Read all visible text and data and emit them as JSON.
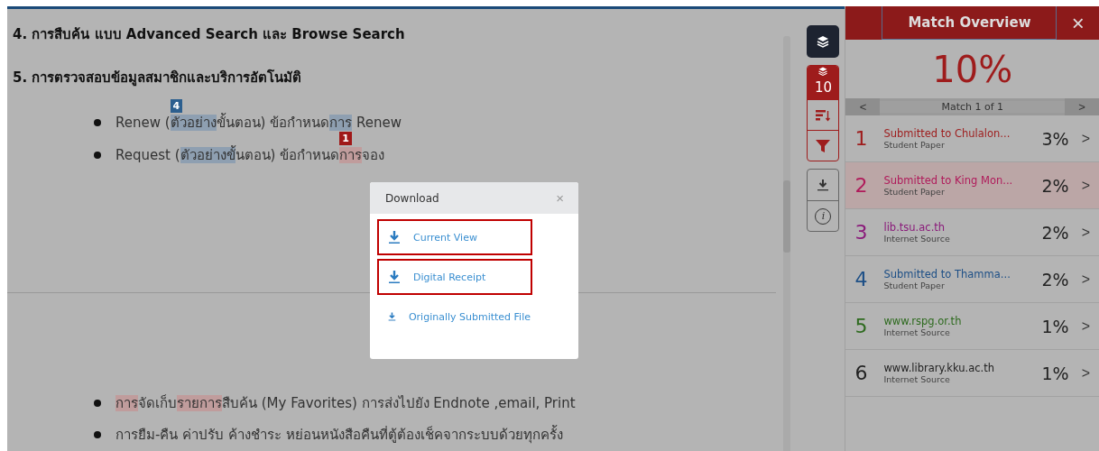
{
  "document": {
    "lines": [
      {
        "kind": "heading",
        "segments": [
          {
            "text": "4. การสืบค้น แบบ Advanced Search และ Browse Search"
          }
        ]
      },
      {
        "kind": "heading",
        "segments": [
          {
            "text": "5. การตรวจสอบข้อมูลสมาชิกและบริการอัตโนมัติ"
          }
        ]
      },
      {
        "kind": "bullet",
        "segments": [
          {
            "text": "Renew ("
          },
          {
            "text": "ตัวอย่าง",
            "color": "#8e9fb1",
            "badge": "4"
          },
          {
            "text": "ขั้นตอน)  ข้อกำหนด"
          },
          {
            "text": "การ",
            "color": "#8e9fb1"
          },
          {
            "text": " Renew"
          }
        ]
      },
      {
        "kind": "bullet",
        "segments": [
          {
            "text": "Request ("
          },
          {
            "text": "ตัวอย่างขั้",
            "color": "#8e9fb1"
          },
          {
            "text": "นตอน) ข้อกำหนด"
          },
          {
            "text": "การ",
            "color": "#c09c9c",
            "badge": "1"
          },
          {
            "text": "จอง"
          }
        ]
      },
      {
        "kind": "break"
      },
      {
        "kind": "bullet",
        "segments": [
          {
            "text": "การ",
            "color": "#c09c9c"
          },
          {
            "text": "จัดเก็บ"
          },
          {
            "text": "รายการ",
            "color": "#c09c9c"
          },
          {
            "text": "สืบค้น (My Favorites)  การส่งไปยัง Endnote ,email, Print"
          }
        ]
      },
      {
        "kind": "bullet",
        "segments": [
          {
            "text": "การยืม-คืน ค่าปรับ ค้างชำระ หย่อนหนังสือคืนที่ตู้ต้องเช็คจากระบบด้วยทุกครั้ง"
          }
        ]
      }
    ]
  },
  "toolbar": {
    "match_count": "10",
    "info": "i"
  },
  "dialog": {
    "title": "Download",
    "close": "×",
    "options": [
      {
        "label": "Current View",
        "outlined": true
      },
      {
        "label": "Digital Receipt",
        "outlined": true
      },
      {
        "label": "Originally Submitted File",
        "outlined": false
      }
    ]
  },
  "panel": {
    "title": "Match Overview",
    "close": "×",
    "score": "10%",
    "nav_label": "Match 1 of 1",
    "prev": "<",
    "next": ">",
    "matches": [
      {
        "number": "1",
        "source": "Submitted to Chulalon...",
        "type": "Student Paper",
        "percent": "3%",
        "color": "#9e1c1c",
        "selected": false
      },
      {
        "number": "2",
        "source": "Submitted to King Mon...",
        "type": "Student Paper",
        "percent": "2%",
        "color": "#b01a5a",
        "selected": true
      },
      {
        "number": "3",
        "source": "lib.tsu.ac.th",
        "type": "Internet Source",
        "percent": "2%",
        "color": "#8a1a7a",
        "selected": false
      },
      {
        "number": "4",
        "source": "Submitted to Thamma...",
        "type": "Student Paper",
        "percent": "2%",
        "color": "#1d4f86",
        "selected": false
      },
      {
        "number": "5",
        "source": "www.rspg.or.th",
        "type": "Internet Source",
        "percent": "1%",
        "color": "#2d6a1e",
        "selected": false
      },
      {
        "number": "6",
        "source": "www.library.kku.ac.th",
        "type": "Internet Source",
        "percent": "1%",
        "color": "#222222",
        "selected": false
      }
    ]
  }
}
